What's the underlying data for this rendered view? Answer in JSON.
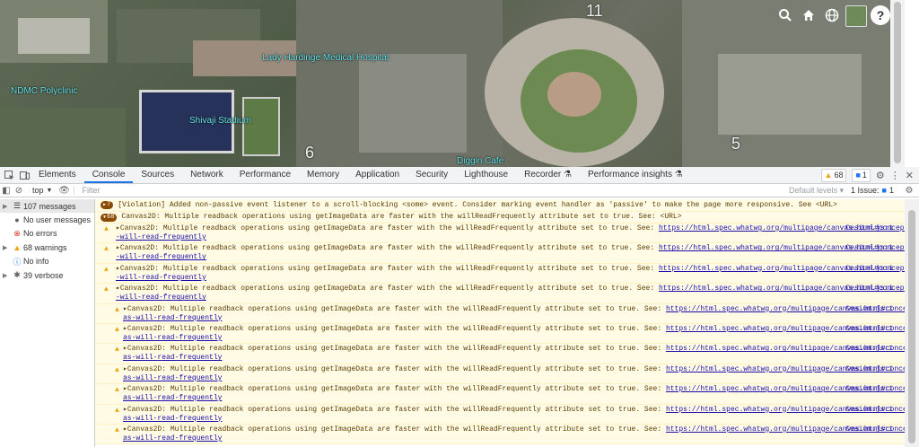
{
  "map": {
    "labels": {
      "hospital": "Lady Hardinge Medical Hospital",
      "polyclinic": "NDMC Polyclinic",
      "stadium": "Shivaji Stadium",
      "cafe": "Diggin Cafe"
    },
    "numbers": {
      "n11": "11",
      "n6": "6",
      "n5": "5"
    },
    "tools": [
      "search-icon",
      "home-icon",
      "globe-icon",
      "imagery-icon",
      "help-icon"
    ],
    "help_label": "?"
  },
  "devtools": {
    "tabs": [
      "Elements",
      "Console",
      "Sources",
      "Network",
      "Performance",
      "Memory",
      "Application",
      "Security",
      "Lighthouse",
      "Recorder",
      "Performance insights"
    ],
    "active_tab": "Console",
    "warnings_count": "68",
    "info_count": "1"
  },
  "console_toolbar": {
    "context": "top",
    "filter_placeholder": "Filter",
    "levels": "Default levels",
    "issues_label": "1 Issue:",
    "issues_count": "1"
  },
  "sidebar": [
    {
      "label": "107 messages",
      "icon": "list-icon"
    },
    {
      "label": "No user messages",
      "icon": "user-icon"
    },
    {
      "label": "No errors",
      "icon": "error-icon"
    },
    {
      "label": "68 warnings",
      "icon": "warning-icon"
    },
    {
      "label": "No info",
      "icon": "info-icon"
    },
    {
      "label": "39 verbose",
      "icon": "verbose-icon"
    }
  ],
  "messages": {
    "violation_count": "7",
    "violation_text": "[Violation] Added non-passive event listener to a scroll-blocking <some> event. Consider marking event handler as 'passive' to make the page more responsive. See <URL>",
    "group_count": "68",
    "group_text": "Canvas2D: Multiple readback operations using getImageData are faster with the willReadFrequently attribute set to true. See: <URL>",
    "warning_text": "Canvas2D: Multiple readback operations using getImageData are faster with the willReadFrequently attribute set to true. See: ",
    "link_a": "https://html.spec.whatwg.org/multipage/canvas.html#concept-canvas",
    "link_a_cont": "-will-read-frequently",
    "link_b": "https://html.spec.whatwg.org/multipage/canvas.html#concept-canv",
    "link_b_cont": "as-will-read-frequently",
    "source": "Cesium.js:1"
  }
}
